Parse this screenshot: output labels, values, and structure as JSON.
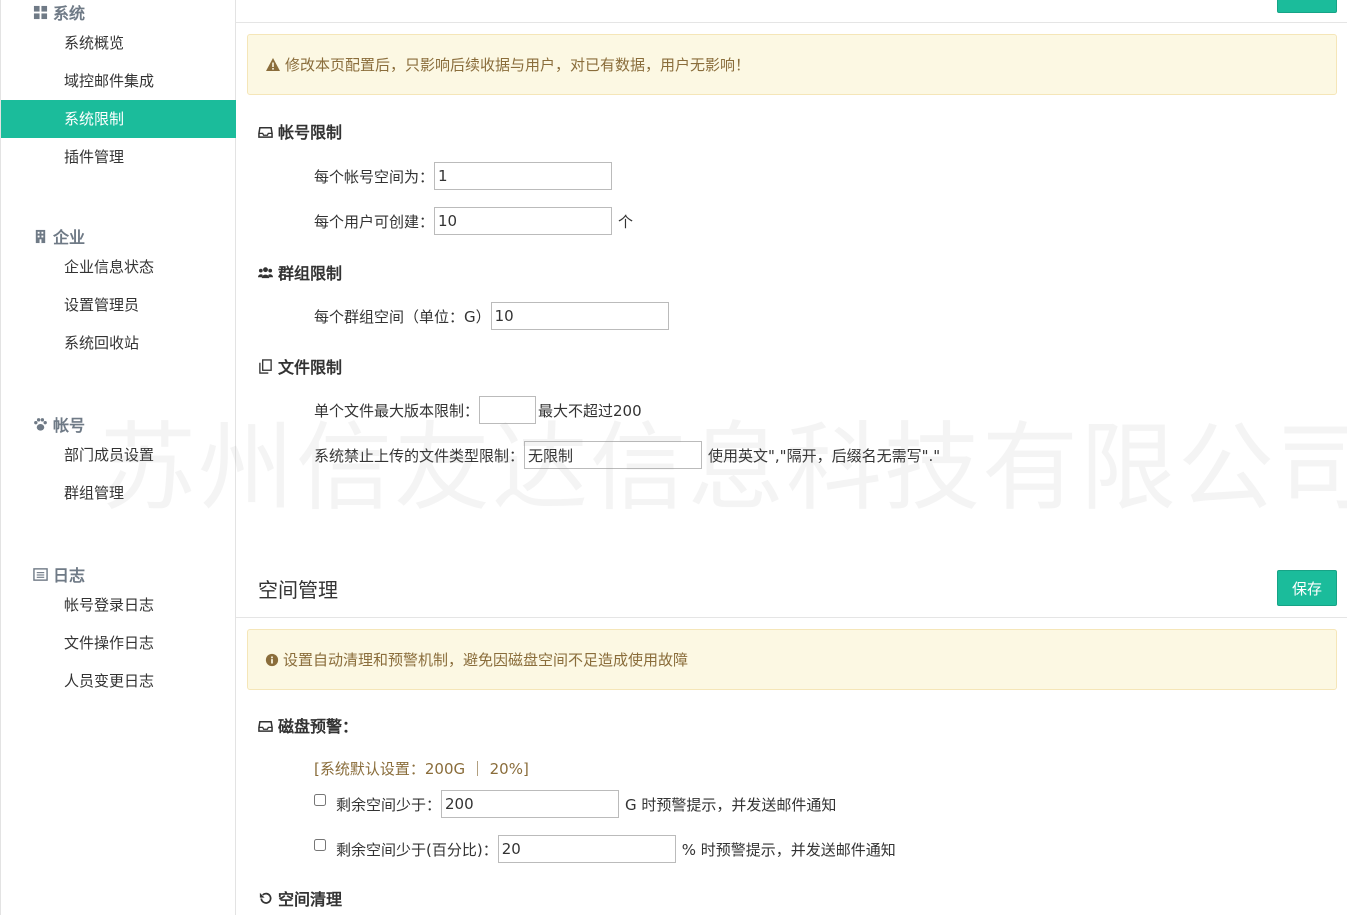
{
  "sidebar": {
    "groups": [
      {
        "title": "系统",
        "icon": "grid-icon",
        "items": [
          "系统概览",
          "域控邮件集成",
          "系统限制",
          "插件管理"
        ],
        "active": 2
      },
      {
        "title": "企业",
        "icon": "building-icon",
        "items": [
          "企业信息状态",
          "设置管理员",
          "系统回收站"
        ]
      },
      {
        "title": "帐号",
        "icon": "paw-icon",
        "items": [
          "部门成员设置",
          "群组管理"
        ]
      },
      {
        "title": "日志",
        "icon": "list-icon",
        "items": [
          "帐号登录日志",
          "文件操作日志",
          "人员变更日志"
        ]
      }
    ]
  },
  "limits": {
    "alert": "修改本页配置后，只影响后续收据与用户，对已有数据，用户无影响！",
    "account": {
      "title": "帐号限制",
      "space_label": "每个帐号空间为：",
      "space_value": "1",
      "create_label": "每个用户可创建：",
      "create_value": "10",
      "create_suffix": "个"
    },
    "group": {
      "title": "群组限制",
      "space_label": "每个群组空间（单位：G）",
      "space_value": "10"
    },
    "file": {
      "title": "文件限制",
      "version_label": "单个文件最大版本限制：",
      "version_value": "",
      "version_suffix": "最大不超过200",
      "type_label": "系统禁止上传的文件类型限制：",
      "type_value": "无限制",
      "type_suffix": "使用英文\",\"隔开，后缀名无需写\".\""
    }
  },
  "space": {
    "title": "空间管理",
    "save_label": "保存",
    "alert": "设置自动清理和预警机制，避免因磁盘空间不足造成使用故障",
    "warning_title": "磁盘预警：",
    "default_note": "[系统默认设置：200G ｜ 20%]",
    "remain_label": "剩余空间少于：",
    "remain_value": "200",
    "remain_suffix": "G 时预警提示，并发送邮件通知",
    "percent_label": "剩余空间少于(百分比)：",
    "percent_value": "20",
    "percent_suffix": "% 时预警提示，并发送邮件通知",
    "clean_title": "空间清理"
  },
  "watermark": "苏州信友达信息科技有限公司",
  "colors": {
    "accent": "#1bbc9b",
    "alert_bg": "#fcf8e3",
    "alert_text": "#8a6d3b"
  }
}
